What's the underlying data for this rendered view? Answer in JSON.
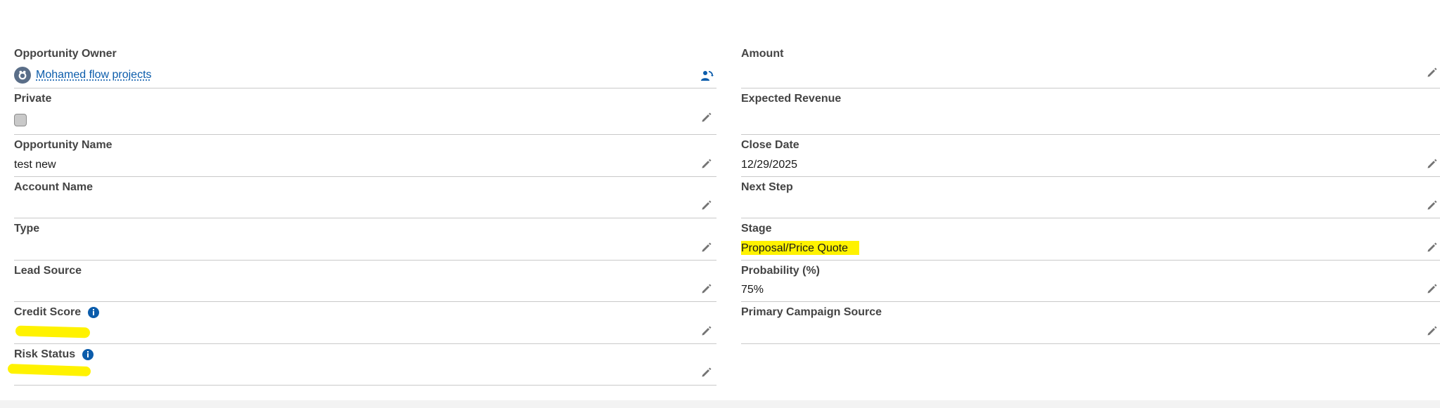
{
  "left_fields": [
    {
      "label": "Opportunity Owner",
      "value": "Mohamed flow projects"
    },
    {
      "label": "Private",
      "value": ""
    },
    {
      "label": "Opportunity Name",
      "value": "test new"
    },
    {
      "label": "Account Name",
      "value": ""
    },
    {
      "label": "Type",
      "value": ""
    },
    {
      "label": "Lead Source",
      "value": ""
    },
    {
      "label": "Credit Score",
      "value": ""
    },
    {
      "label": "Risk Status",
      "value": ""
    }
  ],
  "right_fields": [
    {
      "label": "Amount",
      "value": ""
    },
    {
      "label": "Expected Revenue",
      "value": ""
    },
    {
      "label": "Close Date",
      "value": "12/29/2025"
    },
    {
      "label": "Next Step",
      "value": ""
    },
    {
      "label": "Stage",
      "value": "Proposal/Price Quote"
    },
    {
      "label": "Probability (%)",
      "value": "75%"
    },
    {
      "label": "Primary Campaign Source",
      "value": ""
    }
  ],
  "icons": {
    "edit": "pencil-icon",
    "info": "info-icon",
    "owner_avatar": "user-avatar-icon",
    "change_owner": "change-owner-icon"
  },
  "colors": {
    "link": "#0b5cab",
    "highlight": "#fff200",
    "divider": "#c9c9c9",
    "label": "#444444"
  }
}
